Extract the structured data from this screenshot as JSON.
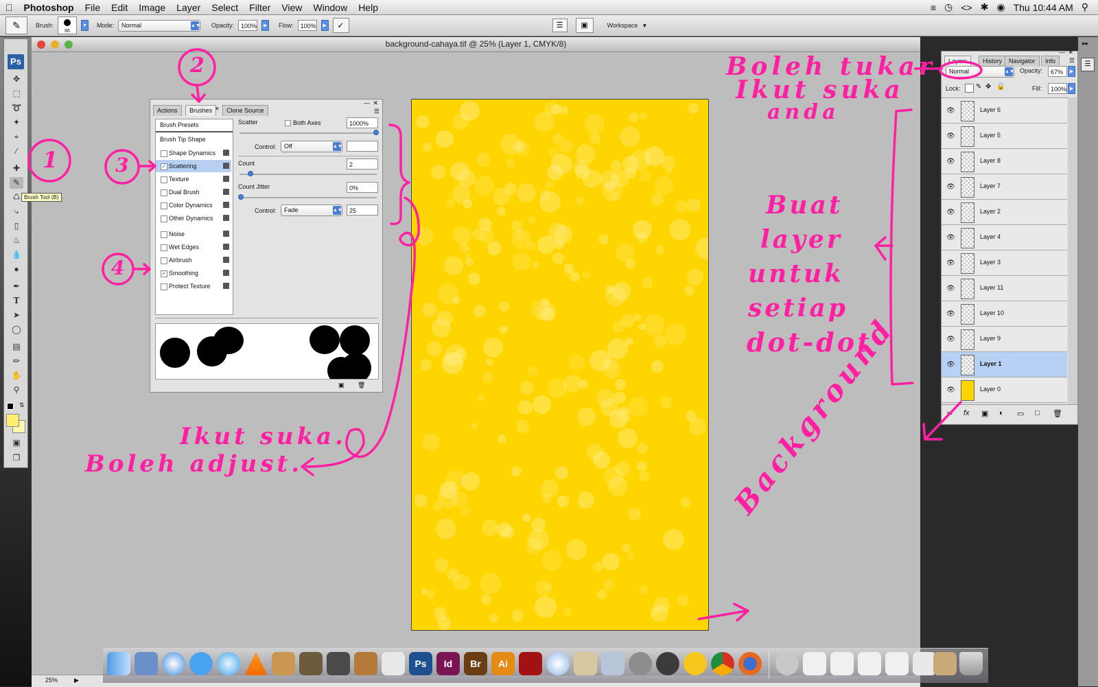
{
  "menubar": {
    "app_name": "Photoshop",
    "items": [
      "File",
      "Edit",
      "Image",
      "Layer",
      "Select",
      "Filter",
      "View",
      "Window",
      "Help"
    ],
    "clock": "Thu 10:44 AM"
  },
  "options_bar": {
    "brush_label": "Brush:",
    "brush_size": "86",
    "mode_label": "Mode:",
    "mode_value": "Normal",
    "opacity_label": "Opacity:",
    "opacity_value": "100%",
    "flow_label": "Flow:",
    "flow_value": "100%",
    "workspace_label": "Workspace"
  },
  "toolbox": {
    "logo": "Ps",
    "tooltip": "Brush Tool (B)"
  },
  "document": {
    "title": "background-cahaya.tif @ 25% (Layer 1, CMYK/8)",
    "zoom": "25%",
    "colors": {
      "canvas": "#ffd500",
      "accent": "#ff1fa3"
    }
  },
  "brushes_panel": {
    "tabs": [
      "Actions",
      "Brushes",
      "Clone Source"
    ],
    "presets_label": "Brush Presets",
    "tip_shape_label": "Brush Tip Shape",
    "options": [
      {
        "label": "Shape Dynamics",
        "checked": false
      },
      {
        "label": "Scattering",
        "checked": true
      },
      {
        "label": "Texture",
        "checked": false
      },
      {
        "label": "Dual Brush",
        "checked": false
      },
      {
        "label": "Color Dynamics",
        "checked": false
      },
      {
        "label": "Other Dynamics",
        "checked": false
      },
      {
        "label": "Noise",
        "checked": false
      },
      {
        "label": "Wet Edges",
        "checked": false
      },
      {
        "label": "Airbrush",
        "checked": false
      },
      {
        "label": "Smoothing",
        "checked": true
      },
      {
        "label": "Protect Texture",
        "checked": false
      }
    ],
    "scatter_label": "Scatter",
    "both_axes_label": "Both Axes",
    "scatter_value": "1000%",
    "control_label": "Control:",
    "control1_value": "Off",
    "count_label": "Count",
    "count_value": "2",
    "count_jitter_label": "Count Jitter",
    "count_jitter_value": "0%",
    "control2_value": "Fade",
    "fade_value": "25"
  },
  "layers_panel": {
    "tabs": [
      "Layers",
      "History",
      "Navigator",
      "Info"
    ],
    "blend_mode": "Normal",
    "opacity_label": "Opacity:",
    "opacity_value": "67%",
    "lock_label": "Lock:",
    "fill_label": "Fill:",
    "fill_value": "100%",
    "layers": [
      {
        "name": "Layer 6",
        "selected": false
      },
      {
        "name": "Layer 5",
        "selected": false
      },
      {
        "name": "Layer 8",
        "selected": false
      },
      {
        "name": "Layer 7",
        "selected": false
      },
      {
        "name": "Layer 2",
        "selected": false
      },
      {
        "name": "Layer 4",
        "selected": false
      },
      {
        "name": "Layer 3",
        "selected": false
      },
      {
        "name": "Layer 11",
        "selected": false
      },
      {
        "name": "Layer 10",
        "selected": false
      },
      {
        "name": "Layer 9",
        "selected": false
      },
      {
        "name": "Layer 1",
        "selected": true
      },
      {
        "name": "Layer 0",
        "selected": false
      }
    ]
  },
  "dock": {
    "app_labels": [
      "Ps",
      "Id",
      "Br",
      "Ai"
    ]
  },
  "annotations": {
    "num1": "1",
    "num2": "2",
    "num3": "3",
    "num4": "4",
    "note_blend": [
      "Boleh tukar",
      "Ikut suka",
      "anda"
    ],
    "note_layers": [
      "Buat",
      "layer",
      "untuk",
      "setiap",
      "dot-dot"
    ],
    "note_adjust": [
      "Ikut suka.",
      "Boleh adjust."
    ],
    "note_background": "Background"
  }
}
